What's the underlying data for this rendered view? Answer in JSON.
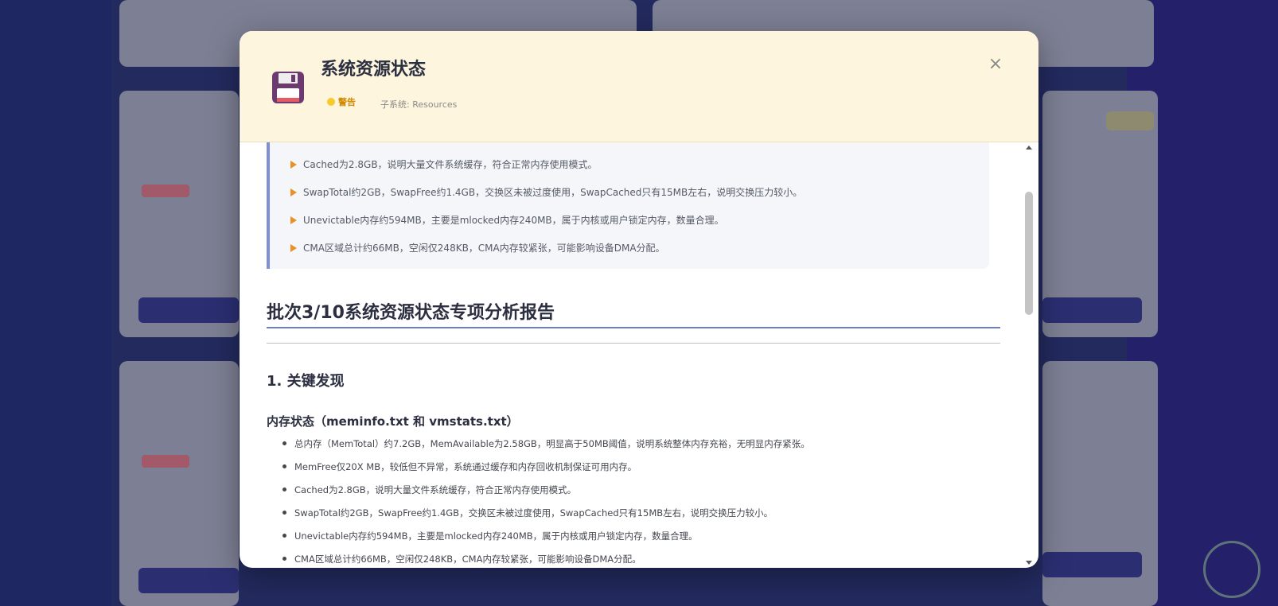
{
  "modal": {
    "title": "系统资源状态",
    "badge": "警告",
    "subsystem": "子系统: Resources",
    "close_symbol": "×",
    "icon": "floppy-disk-icon"
  },
  "callout_items": [
    "Cached为2.8GB，说明大量文件系统缓存，符合正常内存使用模式。",
    "SwapTotal约2GB，SwapFree约1.4GB，交换区未被过度使用，SwapCached只有15MB左右，说明交换压力较小。",
    "Unevictable内存约594MB，主要是mlocked内存240MB，属于内核或用户锁定内存，数量合理。",
    "CMA区域总计约66MB，空闲仅248KB，CMA内存较紧张，可能影响设备DMA分配。"
  ],
  "report": {
    "title": "批次3/10系统资源状态专项分析报告",
    "section_heading": "1. 关键发现",
    "sub_heading": "内存状态（meminfo.txt 和 vmstats.txt）",
    "items": [
      "总内存（MemTotal）约7.2GB，MemAvailable为2.58GB，明显高于50MB阈值，说明系统整体内存充裕，无明显内存紧张。",
      "MemFree仅20X MB，较低但不异常，系统通过缓存和内存回收机制保证可用内存。",
      "Cached为2.8GB，说明大量文件系统缓存，符合正常内存使用模式。",
      "SwapTotal约2GB，SwapFree约1.4GB，交换区未被过度使用，SwapCached只有15MB左右，说明交换压力较小。",
      "Unevictable内存约594MB，主要是mlocked内存240MB，属于内核或用户锁定内存，数量合理。",
      "CMA区域总计约66MB，空闲仅248KB，CMA内存较紧张，可能影响设备DMA分配。"
    ]
  },
  "colors": {
    "header_bg": "#fdf5dd",
    "accent_bar": "#7f8fd6",
    "warning": "#f4cb2a",
    "bullet_marker": "#e99127"
  }
}
